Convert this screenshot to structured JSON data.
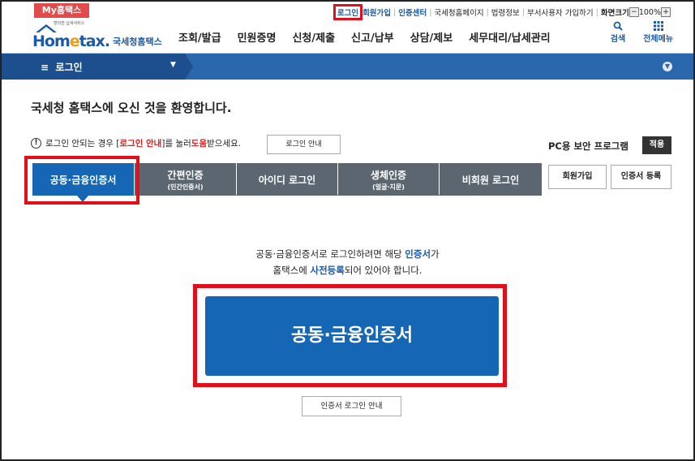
{
  "topbar": {
    "my_tab": "My홈택스",
    "login": "로그인",
    "signup": "회원가입",
    "cert_center": "인증센터",
    "nts_page": "국세청홈페이지",
    "law_info": "법령정보",
    "dept_user": "부서사용자 가입하기",
    "screen_size": "화면크기",
    "zoom_minus": "−",
    "zoom_value": "100%",
    "zoom_plus": "+"
  },
  "header": {
    "logo_sub": "편리한 납세서비스",
    "logo_main_pre": "Hom",
    "logo_main_e": "e",
    "logo_main_post": "tax.",
    "logo_kr": "국세청홈택스",
    "nav": [
      "조회/발급",
      "민원증명",
      "신청/제출",
      "신고/납부",
      "상담/제보",
      "세무대리/납세관리"
    ],
    "search": "검색",
    "all_menu": "전체메뉴"
  },
  "bluebar": {
    "menu_glyph": "≡",
    "crumb": "로그인"
  },
  "content": {
    "welcome": "국세청 홈택스에 오신 것을 환영합니다.",
    "notice_pre": "로그인 안되는 경우 [",
    "notice_link": "로그인 안내",
    "notice_mid": "]를 눌러 ",
    "notice_help": "도움",
    "notice_post": "받으세요.",
    "notice_button": "로그인 안내",
    "pc_program": "PC용 보안 프로그램",
    "apply": "적용"
  },
  "tabs": [
    {
      "label": "공동·금융인증서",
      "sub": ""
    },
    {
      "label": "간편인증",
      "sub": "(민간인증서)"
    },
    {
      "label": "아이디 로그인",
      "sub": ""
    },
    {
      "label": "생체인증",
      "sub": "(얼굴·지문)"
    },
    {
      "label": "비회원 로그인",
      "sub": ""
    }
  ],
  "side_buttons": {
    "signup": "회원가입",
    "cert_register": "인증서 등록"
  },
  "description": {
    "line1_pre": "공동·금융인증서로 로그인하려면 해당 ",
    "line1_blue": "인증서",
    "line1_post": "가",
    "line2_pre": "홈택스에 ",
    "line2_blue": "사전등록",
    "line2_post": "되어 있어야 합니다."
  },
  "main_button": "공동·금융인증서",
  "guide_button": "인증서 로그인 안내"
}
